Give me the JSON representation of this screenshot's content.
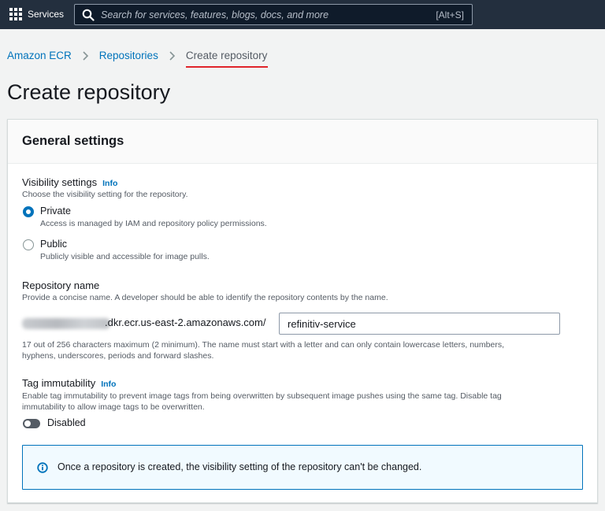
{
  "nav": {
    "services_label": "Services",
    "search_placeholder": "Search for services, features, blogs, docs, and more",
    "search_shortcut": "[Alt+S]"
  },
  "breadcrumb": {
    "items": [
      "Amazon ECR",
      "Repositories"
    ],
    "current": "Create repository"
  },
  "page": {
    "title": "Create repository"
  },
  "general": {
    "header": "General settings",
    "visibility": {
      "label": "Visibility settings",
      "info": "Info",
      "description": "Choose the visibility setting for the repository.",
      "options": [
        {
          "label": "Private",
          "description": "Access is managed by IAM and repository policy permissions.",
          "selected": true
        },
        {
          "label": "Public",
          "description": "Publicly visible and accessible for image pulls.",
          "selected": false
        }
      ]
    },
    "repo_name": {
      "label": "Repository name",
      "description": "Provide a concise name. A developer should be able to identify the repository contents by the name.",
      "uri_suffix": ".dkr.ecr.us-east-2.amazonaws.com/",
      "value": "refinitiv-service",
      "constraint_line1": "17 out of 256 characters maximum (2 minimum). The name must start with a letter and can only contain lowercase letters, numbers,",
      "constraint_line2": "hyphens, underscores, periods and forward slashes."
    },
    "tag_immutability": {
      "label": "Tag immutability",
      "info": "Info",
      "description_line1": "Enable tag immutability to prevent image tags from being overwritten by subsequent image pushes using the same tag. Disable tag",
      "description_line2": "immutability to allow image tags to be overwritten.",
      "state_label": "Disabled"
    },
    "alert": {
      "text": "Once a repository is created, the visibility setting of the repository can't be changed."
    }
  },
  "colors": {
    "nav_bg": "#232f3e",
    "link": "#0073bb",
    "alert_bg": "#f1faff",
    "breadcrumb_underline": "#e0242a"
  }
}
